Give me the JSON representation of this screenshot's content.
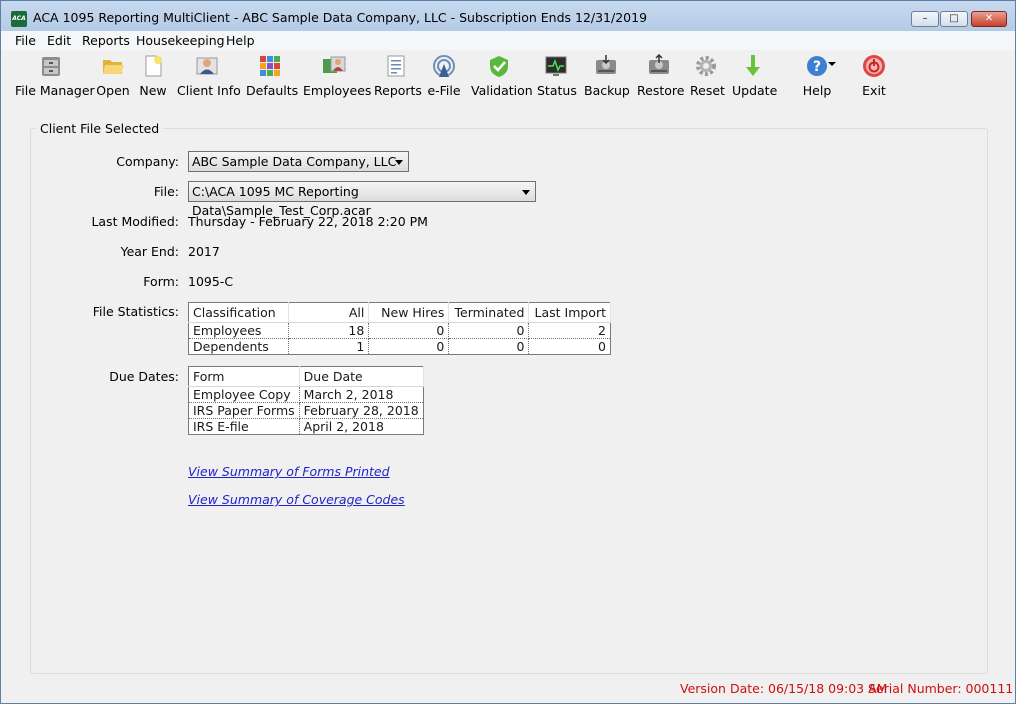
{
  "window": {
    "title": "ACA 1095 Reporting MultiClient - ABC Sample Data Company, LLC - Subscription Ends 12/31/2019",
    "app_icon_text": "ACA"
  },
  "menu": [
    "File",
    "Edit",
    "Reports",
    "Housekeeping",
    "Help"
  ],
  "toolbar": [
    {
      "label": "File Manager",
      "icon": "file-cabinet-icon"
    },
    {
      "label": "Open",
      "icon": "folder-open-icon"
    },
    {
      "label": "New",
      "icon": "new-document-icon"
    },
    {
      "label": "Client Info",
      "icon": "client-person-icon"
    },
    {
      "label": "Defaults",
      "icon": "defaults-grid-icon"
    },
    {
      "label": "Employees",
      "icon": "employees-icon"
    },
    {
      "label": "Reports",
      "icon": "report-document-icon"
    },
    {
      "label": "e-File",
      "icon": "antenna-icon"
    },
    {
      "label": "Validation",
      "icon": "shield-check-icon"
    },
    {
      "label": "Status",
      "icon": "monitor-pulse-icon"
    },
    {
      "label": "Backup",
      "icon": "hard-drive-backup-icon"
    },
    {
      "label": "Restore",
      "icon": "hard-drive-restore-icon"
    },
    {
      "label": "Reset",
      "icon": "gear-icon"
    },
    {
      "label": "Update",
      "icon": "arrow-down-icon"
    },
    {
      "label": "Help",
      "icon": "help-question-icon"
    },
    {
      "label": "Exit",
      "icon": "power-icon"
    }
  ],
  "client": {
    "group_title": "Client File Selected",
    "company_label": "Company:",
    "company_value": "ABC Sample Data Company, LLC",
    "file_label": "File:",
    "file_value": "C:\\ACA 1095 MC Reporting Data\\Sample_Test_Corp.acar",
    "modified_label": "Last Modified:",
    "modified_value": "Thursday - February 22, 2018 2:20 PM",
    "year_label": "Year End:",
    "year_value": "2017",
    "form_label": "Form:",
    "form_value": "1095-C",
    "stats_label": "File Statistics:",
    "due_label": "Due Dates:"
  },
  "stats": {
    "headers": [
      "Classification",
      "All",
      "New Hires",
      "Terminated",
      "Last Import"
    ],
    "rows": [
      [
        "Employees",
        "18",
        "0",
        "0",
        "2"
      ],
      [
        "Dependents",
        "1",
        "0",
        "0",
        "0"
      ]
    ]
  },
  "due_dates": {
    "headers": [
      "Form",
      "Due Date"
    ],
    "rows": [
      [
        "Employee Copy",
        "March 2, 2018"
      ],
      [
        "IRS Paper Forms",
        "February 28, 2018"
      ],
      [
        "IRS E-file",
        "April 2, 2018"
      ]
    ]
  },
  "links": {
    "forms_printed": "View Summary of Forms Printed",
    "coverage_codes": "View Summary of Coverage Codes"
  },
  "status": {
    "version": "Version Date: 06/15/18 09:03 AM",
    "serial": "Serial Number: 000111"
  },
  "colors": {
    "link": "#2222cc",
    "status_text": "#cc1010",
    "title_bar": "#c7d9ee"
  }
}
